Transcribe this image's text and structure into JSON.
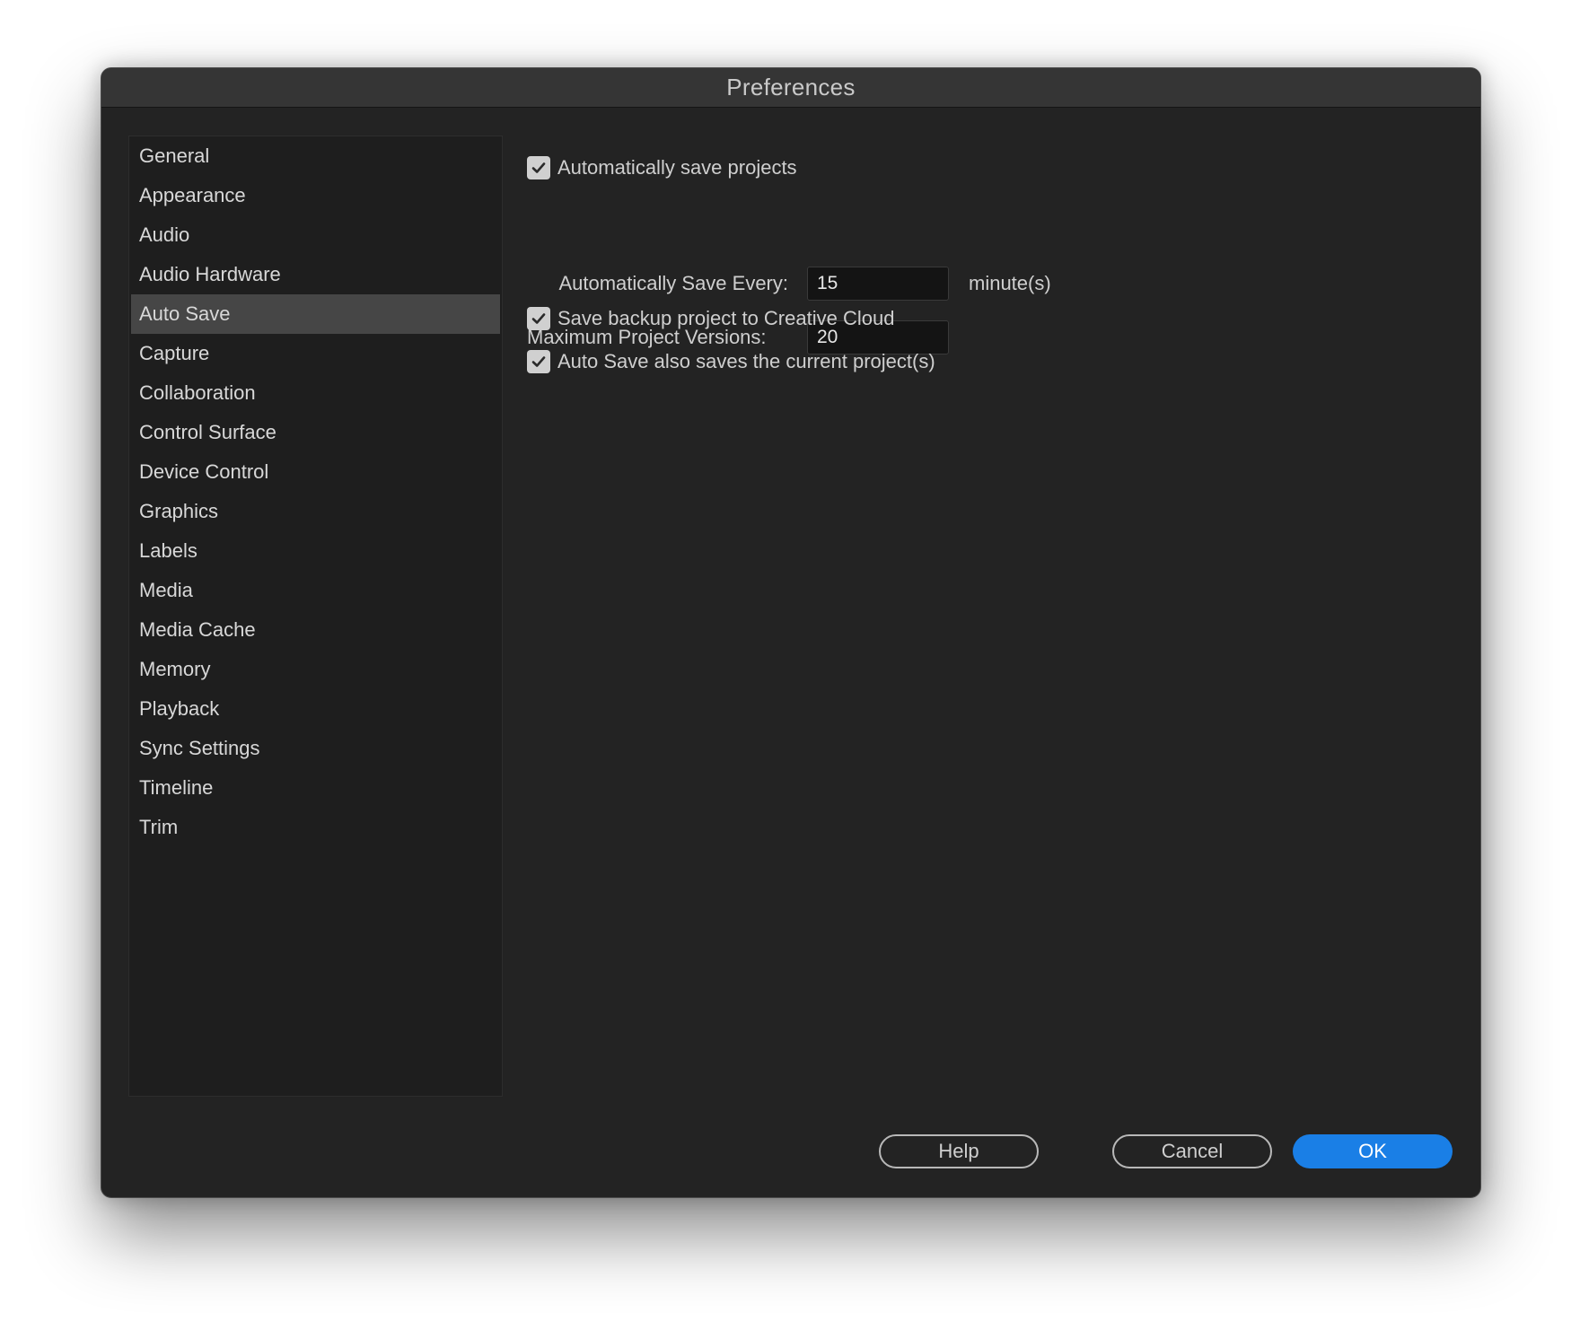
{
  "window": {
    "title": "Preferences"
  },
  "sidebar": {
    "items": [
      {
        "label": "General"
      },
      {
        "label": "Appearance"
      },
      {
        "label": "Audio"
      },
      {
        "label": "Audio Hardware"
      },
      {
        "label": "Auto Save",
        "selected": true
      },
      {
        "label": "Capture"
      },
      {
        "label": "Collaboration"
      },
      {
        "label": "Control Surface"
      },
      {
        "label": "Device Control"
      },
      {
        "label": "Graphics"
      },
      {
        "label": "Labels"
      },
      {
        "label": "Media"
      },
      {
        "label": "Media Cache"
      },
      {
        "label": "Memory"
      },
      {
        "label": "Playback"
      },
      {
        "label": "Sync Settings"
      },
      {
        "label": "Timeline"
      },
      {
        "label": "Trim"
      }
    ]
  },
  "autosave": {
    "auto_save_projects": {
      "label": "Automatically save projects",
      "checked": true
    },
    "save_every": {
      "label": "Automatically Save Every:",
      "value": "15",
      "unit": "minute(s)"
    },
    "max_versions": {
      "label": "Maximum Project Versions:",
      "value": "20"
    },
    "backup_creative_cloud": {
      "label": "Save backup project to Creative Cloud",
      "checked": true
    },
    "saves_current": {
      "label": "Auto Save also saves the current project(s)",
      "checked": true
    }
  },
  "buttons": {
    "help": "Help",
    "cancel": "Cancel",
    "ok": "OK"
  },
  "colors": {
    "accent": "#1a7fe6",
    "background": "#232323",
    "sidebar_selected": "#464646"
  },
  "icons": {
    "checkbox_check": "checkmark-icon"
  }
}
